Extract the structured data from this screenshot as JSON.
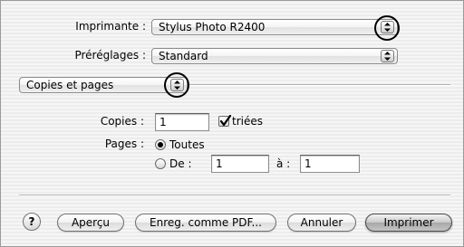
{
  "printer": {
    "label": "Imprimante :",
    "value": "Stylus Photo R2400"
  },
  "presets": {
    "label": "Préréglages :",
    "value": "Standard"
  },
  "section": {
    "value": "Copies et pages"
  },
  "copies": {
    "label": "Copies :",
    "value": "1",
    "collate_label": "triées",
    "collate_checked": true
  },
  "pages": {
    "label": "Pages :",
    "all_label": "Toutes",
    "all_selected": true,
    "from_label": "De :",
    "from_value": "1",
    "to_label": "à :",
    "to_value": "1"
  },
  "buttons": {
    "help": "?",
    "preview": "Aperçu",
    "save_pdf": "Enreg. comme PDF...",
    "cancel": "Annuler",
    "print": "Imprimer"
  },
  "icons": {
    "help": "help-icon",
    "popup_arrows": "up-down-arrows-icon",
    "check": "checkmark-icon",
    "radio": "radio-dot-icon"
  }
}
